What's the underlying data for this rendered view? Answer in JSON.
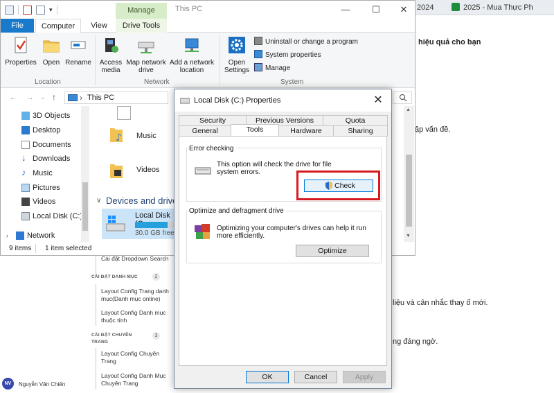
{
  "background": {
    "tabs": [
      {
        "label": "2024"
      },
      {
        "label": "2025 - Mua Thực Ph"
      }
    ],
    "article_lines": [
      "hiệu quả cho bạn",
      "ập vấn đề.",
      "liệu và cân nhắc thay ổ mới.",
      "ng đáng ngờ."
    ],
    "sidebar": {
      "items": [
        {
          "text": "Cài đặt Dropdown Search"
        },
        {
          "head": "CÀI ĐẶT DANH MỤC",
          "badge": "2"
        },
        {
          "text": "Layout Config Trang danh mục(Danh mục online)"
        },
        {
          "text": "Layout Config Danh mục thuộc tính"
        },
        {
          "head": "CÀI ĐẶT CHUYÊN TRANG",
          "badge": "3"
        },
        {
          "text": "Layout Config Chuyên Trang"
        },
        {
          "text": "Layout Config Danh Mục Chuyên Trang"
        }
      ],
      "user_initials": "NV",
      "user_name": "Nguyễn Văn Chiến"
    }
  },
  "explorer": {
    "title": "This PC",
    "contextual_label": "Manage",
    "window_controls": {
      "minimize": "—",
      "maximize": "☐",
      "close": "✕"
    },
    "ribbon_tabs": [
      "File",
      "Computer",
      "View",
      "Drive Tools"
    ],
    "ribbon": {
      "location": {
        "label": "Location",
        "buttons": [
          "Properties",
          "Open",
          "Rename"
        ]
      },
      "network": {
        "label": "Network",
        "buttons": [
          "Access media",
          "Map network drive",
          "Add a network location"
        ]
      },
      "system": {
        "label": "System",
        "open_settings": "Open Settings",
        "small_buttons": [
          "Uninstall or change a program",
          "System properties",
          "Manage"
        ]
      }
    },
    "address": {
      "crumb_arrow": "›",
      "path": "This PC"
    },
    "nav_items": [
      "3D Objects",
      "Desktop",
      "Documents",
      "Downloads",
      "Music",
      "Pictures",
      "Videos",
      "Local Disk (C:)",
      "Network"
    ],
    "folders": [
      "Music",
      "Videos"
    ],
    "devices_heading": "Devices and drive",
    "drive": {
      "name": "Local Disk (C",
      "free": "30.0 GB free",
      "used_fraction": 0.78
    },
    "status": {
      "items": "9 items",
      "selected": "1 item selected"
    }
  },
  "dialog": {
    "title": "Local Disk (C:) Properties",
    "close": "✕",
    "tabs_row1": [
      "Security",
      "Previous Versions",
      "Quota"
    ],
    "tabs_row2": [
      "General",
      "Tools",
      "Hardware",
      "Sharing"
    ],
    "active_tab": "Tools",
    "error_checking": {
      "title": "Error checking",
      "line1": "This option will check the drive for file",
      "line2": "system errors.",
      "button": "Check"
    },
    "optimize": {
      "title": "Optimize and defragment drive",
      "line1": "Optimizing your computer's drives can help it run",
      "line2": "more efficiently.",
      "button": "Optimize"
    },
    "buttons": {
      "ok": "OK",
      "cancel": "Cancel",
      "apply": "Apply"
    }
  },
  "colors": {
    "highlight_box": "#d71920",
    "accent": "#0078d7",
    "file_tab": "#1979ca"
  }
}
